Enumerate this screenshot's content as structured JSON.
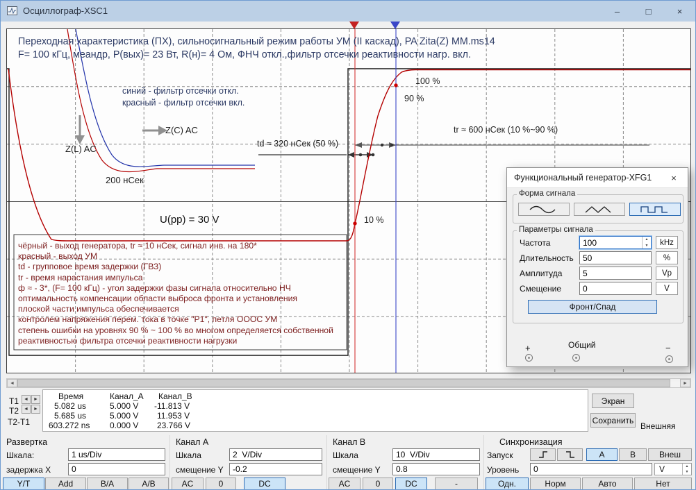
{
  "window": {
    "title": "Осциллограф-XSC1"
  },
  "icons": {
    "minimize": "–",
    "maximize": "□",
    "close": "×",
    "arrow_left": "◄",
    "arrow_right": "►",
    "spin_up": "▲",
    "spin_down": "▼"
  },
  "colors": {
    "trace_black": "#1a1a1a",
    "trace_red": "#b40000",
    "trace_blue": "#2233aa",
    "cursor1": "#d43535",
    "cursor2": "#3a46c8",
    "selected_button_bg": "#cce4f7",
    "selected_button_border": "#2f6eb5",
    "notes_text": "#7d2020",
    "title_text": "#2c3a64"
  },
  "display": {
    "title1": "Переходная характеристика (ПХ), сильносигнальный режим работы УМ (II каскад), PA Zita(Z) MM.ms14",
    "title2": "F= 100 кГц, меандр, P(вых)= 23 Вт, R(н)= 4 Ом, ФНЧ откл.,фильтр отсечки реактивности нагр. вкл.",
    "legend_blue": "синий - фильтр отсечки откл.",
    "legend_red": "красный - фильтр отсечки вкл.",
    "label_zc": "Z(C) AC",
    "label_zl": "Z(L) AC",
    "label_200ns": "200 нСек",
    "label_upp": "U(pp) = 30 V",
    "label_td": "td ≈ 320 нСек (50 %)",
    "label_tr": "tr ≈ 600 нСек (10 %~90 %)",
    "pct100": "100 %",
    "pct90": "90 %",
    "pct10": "10 %",
    "notes": [
      "чёрный - выход генератора, tr ≈ 10 нСек, сигнал инв. на 180*",
      "красный - выход УМ",
      "td - групповое время задержки (ГВЗ)",
      "tr - время нарастания импульса",
      "ф ≈ - 3*, (F= 100 кГц) - угол задержки фазы сигнала относительно НЧ",
      "оптимальность компенсации области выброса фронта и установления",
      "плоской части импульса обеспечивается",
      "контролем напряжения перем. тока в точке \"P1\", петля ОООС УМ",
      "степень ошибки на уровнях 90 % ~ 100 % во многом определяется собственной",
      "реактивностью фильтра отсечки реактивности нагрузки"
    ]
  },
  "measurements": {
    "headers": [
      "Время",
      "Канал_A",
      "Канал_B"
    ],
    "rows": [
      {
        "label": "T1",
        "time": "5.082 us",
        "a": "5.000 V",
        "b": "-11.813 V"
      },
      {
        "label": "T2",
        "time": "5.685 us",
        "a": "5.000 V",
        "b": "11.953 V"
      },
      {
        "label": "T2-T1",
        "time": "603.272 ns",
        "a": "0.000 V",
        "b": "23.766 V"
      }
    ],
    "screen_btn": "Экран",
    "save_btn": "Сохранить",
    "external_label": "Внешняя"
  },
  "timebase": {
    "title": "Развертка",
    "scale_label": "Шкала:",
    "scale": "1 us/Div",
    "xdelay_label": "задержка X",
    "xdelay": "0",
    "modes": [
      "Y/T",
      "Add",
      "B/A",
      "A/B"
    ]
  },
  "channel_a": {
    "title": "Канал A",
    "scale_label": "Шкала",
    "scale": "2  V/Div",
    "offset_label": "смещение Y",
    "offset": "-0.2",
    "coupling": [
      "AC",
      "0",
      "DC"
    ]
  },
  "channel_b": {
    "title": "Канал B",
    "scale_label": "Шкала",
    "scale": "10  V/Div",
    "offset_label": "смещение Y",
    "offset": "0.8",
    "coupling": [
      "AC",
      "0",
      "DC",
      "-"
    ]
  },
  "trigger": {
    "title": "Синхронизация",
    "edge_label": "Запуск",
    "sources": [
      "A",
      "B",
      "Внеш"
    ],
    "level_label": "Уровень",
    "level": "0",
    "unit": "V",
    "modes": [
      "Одн.",
      "Норм",
      "Авто",
      "Нет"
    ]
  },
  "generator": {
    "title": "Функциональный генератор-XFG1",
    "waveform_group": "Форма сигнала",
    "params_group": "Параметры сигнала",
    "rows": [
      {
        "label": "Частота",
        "value": "100",
        "unit": "kHz"
      },
      {
        "label": "Длительность",
        "value": "50",
        "unit": "%"
      },
      {
        "label": "Амплитуда",
        "value": "5",
        "unit": "Vp"
      },
      {
        "label": "Смещение",
        "value": "0",
        "unit": "V"
      }
    ],
    "edge_button": "Фронт/Спад",
    "terminals": {
      "plus": "+",
      "common": "Общий",
      "minus": "−"
    }
  }
}
